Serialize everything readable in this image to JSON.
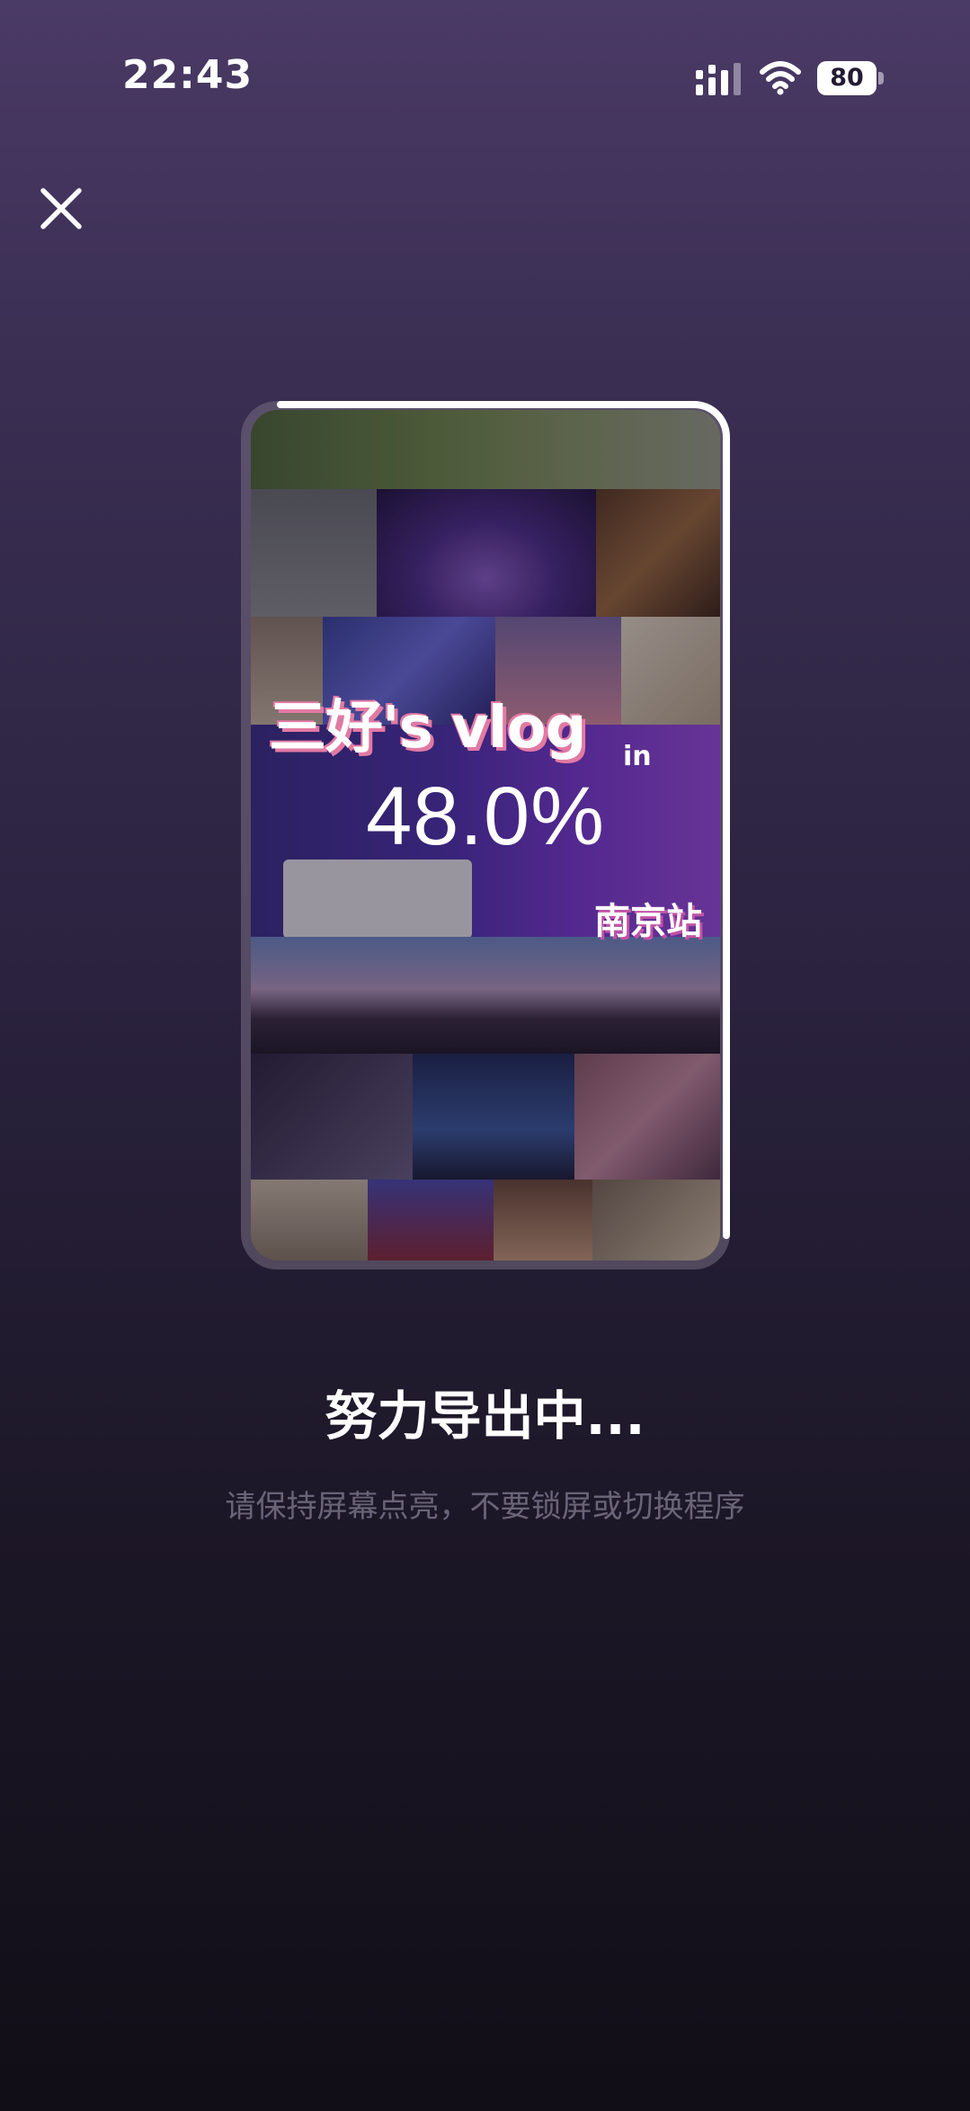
{
  "status_bar": {
    "time": "22:43",
    "battery_level": "80",
    "icons": [
      "cellular-signal-icon",
      "wifi-icon",
      "battery-icon"
    ]
  },
  "close": {
    "icon": "close-icon"
  },
  "preview": {
    "overlay_title": "三好's vlog",
    "overlay_in": "in",
    "overlay_station": "南京站"
  },
  "progress": {
    "percent_text": "48.0%",
    "value": 0.48
  },
  "export": {
    "title": "努力导出中...",
    "hint": "请保持屏幕点亮，不要锁屏或切换程序"
  },
  "colors": {
    "background_top": "#4a3a66",
    "background_bottom": "#110e17",
    "progress_ring": "#ffffff",
    "hint_text": "#6a6478"
  }
}
